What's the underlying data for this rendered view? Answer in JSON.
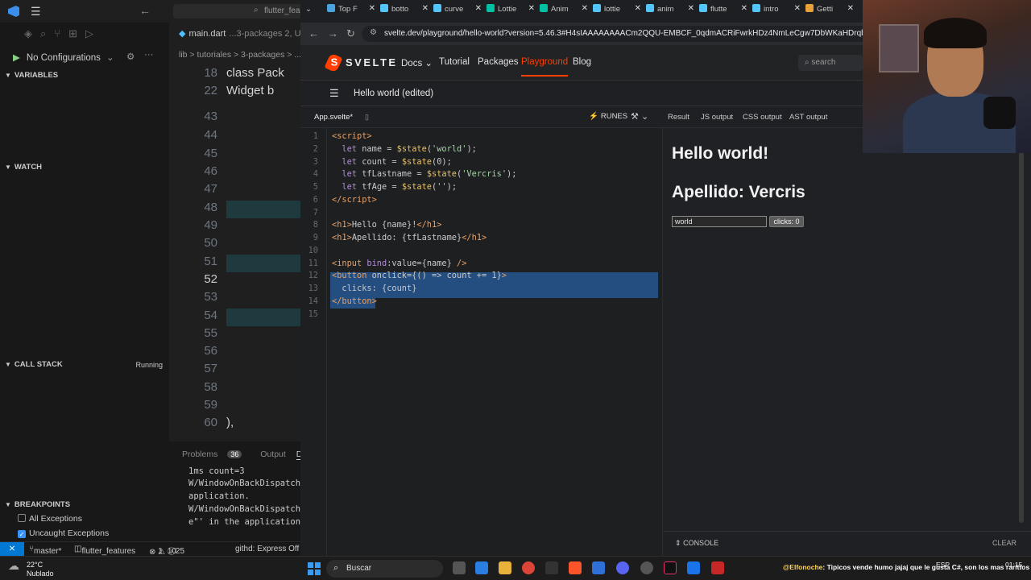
{
  "vscode": {
    "search_text": "flutter_fea",
    "run": {
      "config_label": "No Configurations"
    },
    "sections": {
      "variables": "VARIABLES",
      "watch": "WATCH",
      "call_stack": "CALL STACK",
      "call_stack_status": "Running",
      "breakpoints": "BREAKPOINTS"
    },
    "breakpoints": [
      {
        "label": "All Exceptions",
        "checked": false
      },
      {
        "label": "Uncaught Exceptions",
        "checked": true
      }
    ],
    "editor": {
      "tab": "main.dart",
      "tab_path": "...3-packages 2, U",
      "breadcrumb": "lib > tutoriales > 3-packages > ...",
      "lines": [
        {
          "num": "18",
          "text": "class Pack"
        },
        {
          "num": "22",
          "text": "  Widget b"
        },
        {
          "num": "43",
          "text": ""
        },
        {
          "num": "44",
          "text": ""
        },
        {
          "num": "45",
          "text": ""
        },
        {
          "num": "46",
          "text": ""
        },
        {
          "num": "47",
          "text": ""
        },
        {
          "num": "48",
          "text": ""
        },
        {
          "num": "49",
          "text": ""
        },
        {
          "num": "50",
          "text": ""
        },
        {
          "num": "51",
          "text": ""
        },
        {
          "num": "52",
          "text": ""
        },
        {
          "num": "53",
          "text": ""
        },
        {
          "num": "54",
          "text": ""
        },
        {
          "num": "55",
          "text": ""
        },
        {
          "num": "56",
          "text": ""
        },
        {
          "num": "57",
          "text": ""
        },
        {
          "num": "58",
          "text": ""
        },
        {
          "num": "59",
          "text": ""
        },
        {
          "num": "60",
          "text": "        ),  "
        }
      ]
    },
    "panel": {
      "tabs": [
        "Problems",
        "Output",
        "Debu"
      ],
      "problems_count": "36",
      "log": [
        "1ms count=3",
        "W/WindowOnBackDispatche",
        "application.",
        "W/WindowOnBackDispatche",
        "e\"' in the application"
      ]
    },
    "status": {
      "branch": "master*",
      "project": "flutter_features",
      "errors": "1",
      "warnings": "10",
      "info": "25",
      "extra": "githd: Express Off"
    }
  },
  "browser": {
    "tabs": [
      {
        "title": "Top F",
        "color": "#4aa3df"
      },
      {
        "title": "botto",
        "color": "#54c5f8"
      },
      {
        "title": "curve",
        "color": "#54c5f8"
      },
      {
        "title": "Lottie",
        "color": "#00c1a4"
      },
      {
        "title": "Anim",
        "color": "#00c1a4"
      },
      {
        "title": "lottie",
        "color": "#54c5f8"
      },
      {
        "title": "anim",
        "color": "#54c5f8"
      },
      {
        "title": "flutte",
        "color": "#54c5f8"
      },
      {
        "title": "intro",
        "color": "#54c5f8"
      },
      {
        "title": "Getti",
        "color": "#e8a13a"
      }
    ],
    "url": "svelte.dev/playground/hello-world?version=5.46.3#H4sIAAAAAAAACm2QQU-EMBCF_0qdmACRiFwrkHDz4NmLeCgw7DbWKaHDrqbhv5vCb...",
    "svelte_nav": {
      "brand": "SVELTE",
      "links": [
        "Docs",
        "Tutorial",
        "Packages",
        "Playground",
        "Blog"
      ],
      "active": "Playground",
      "search_placeholder": "search"
    },
    "playground": {
      "title": "Hello world (edited)",
      "file_tab": "App.svelte*",
      "runes_label": "RUNES",
      "output_tabs": [
        "Result",
        "JS output",
        "CSS output",
        "AST output"
      ],
      "active_output": "Result"
    },
    "code_lines": [
      {
        "n": "1",
        "html": "<span class=\"tag\">&lt;script&gt;</span>"
      },
      {
        "n": "2",
        "html": "  <span class=\"kw\">let</span> name = <span class=\"fn\">$state</span>(<span class=\"str\">'world'</span>);"
      },
      {
        "n": "3",
        "html": "  <span class=\"kw\">let</span> count = <span class=\"fn\">$state</span>(0);"
      },
      {
        "n": "4",
        "html": "  <span class=\"kw\">let</span> tfLastname = <span class=\"fn\">$state</span>(<span class=\"str\">'Vercris'</span>);"
      },
      {
        "n": "5",
        "html": "  <span class=\"kw\">let</span> tfAge = <span class=\"fn\">$state</span>(<span class=\"str\">''</span>);"
      },
      {
        "n": "6",
        "html": "<span class=\"tag\">&lt;/script&gt;</span>"
      },
      {
        "n": "7",
        "html": ""
      },
      {
        "n": "8",
        "html": "<span class=\"tag\">&lt;h1&gt;</span>Hello {name}!<span class=\"tag\">&lt;/h1&gt;</span>"
      },
      {
        "n": "9",
        "html": "<span class=\"tag\">&lt;h1&gt;</span>Apellido: {tfLastname}<span class=\"tag\">&lt;/h1&gt;</span>"
      },
      {
        "n": "10",
        "html": ""
      },
      {
        "n": "11",
        "html": "<span class=\"tag\">&lt;input</span> <span class=\"kw\">bind</span>:value={name} <span class=\"tag\">/&gt;</span>"
      },
      {
        "n": "12",
        "html": "<span class=\"tag\">&lt;button</span> onclick={() =&gt; count += 1}<span class=\"tag\">&gt;</span>"
      },
      {
        "n": "13",
        "html": "  clicks: {count}"
      },
      {
        "n": "14",
        "html": "<span class=\"tag\">&lt;/button&gt;</span>"
      },
      {
        "n": "15",
        "html": ""
      }
    ],
    "result": {
      "h1_hello": "Hello world!",
      "h1_apellido": "Apellido: Vercris",
      "input_value": "world",
      "button_label": "clicks: 0"
    },
    "console": {
      "label": "CONSOLE",
      "clear": "CLEAR"
    }
  },
  "taskbar": {
    "weather_temp": "22°C",
    "weather_desc": "Nublado",
    "search_label": "Buscar",
    "chat_user": "@Elfonoche",
    "chat_msg": ": Tipicos vende humo jajaj que le gusta C#, son los mas rarittos",
    "lang": "ESP",
    "time": "01:15"
  }
}
